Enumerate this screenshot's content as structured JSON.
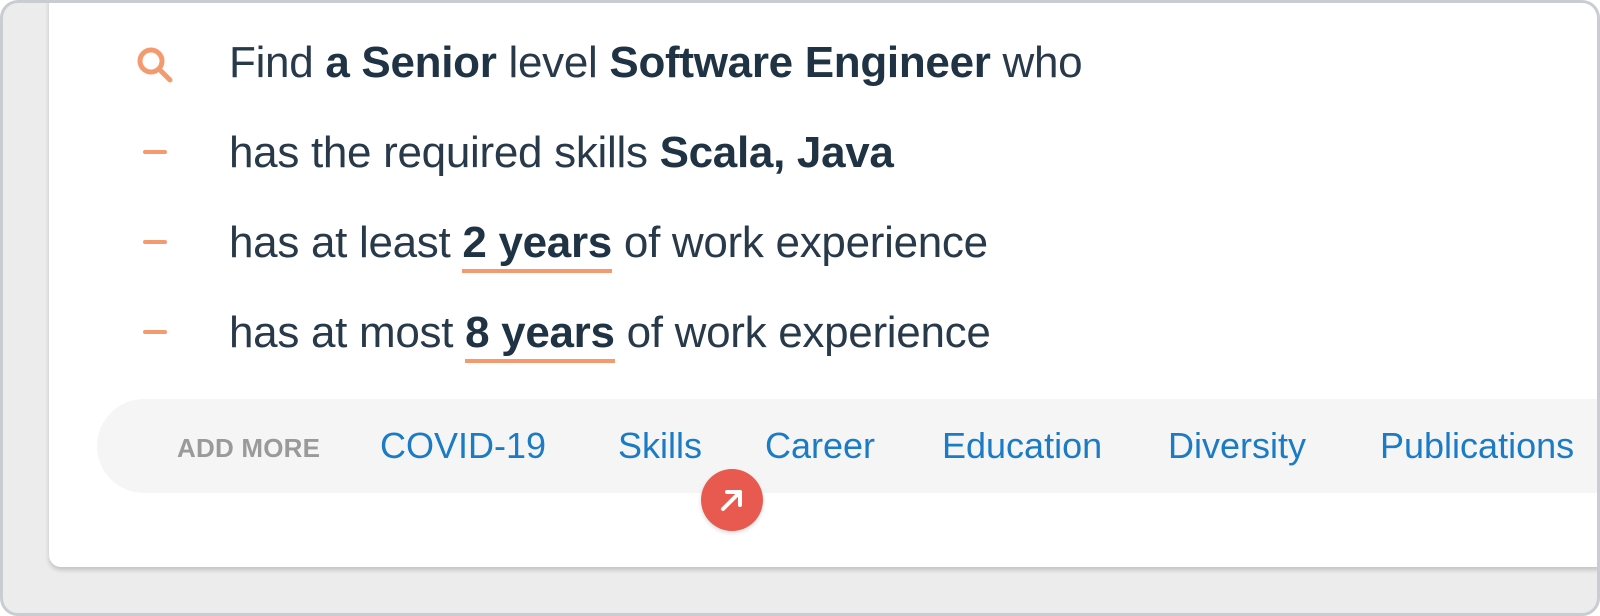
{
  "query": {
    "line1": {
      "parts": [
        "Find ",
        "a Senior",
        " level ",
        "Software Engineer",
        " who"
      ]
    },
    "line2": {
      "parts": [
        "has the required skills ",
        "Scala, Java"
      ]
    },
    "line3": {
      "parts": [
        "has at least ",
        "2 years",
        " of work experience"
      ]
    },
    "line4": {
      "parts": [
        "has at most ",
        "8 years",
        " of work experience"
      ]
    }
  },
  "tagbar": {
    "add_more_label": "ADD MORE",
    "tags": [
      "COVID-19",
      "Skills",
      "Career",
      "Education",
      "Diversity",
      "Publications"
    ]
  },
  "icons": {
    "search": "search-icon",
    "bullet": "dash-icon",
    "fab": "arrow-up-right-icon"
  },
  "colors": {
    "accent": "#f59a6e",
    "text": "#28394a",
    "link": "#1b7bc4",
    "fab": "#e85a4f"
  }
}
